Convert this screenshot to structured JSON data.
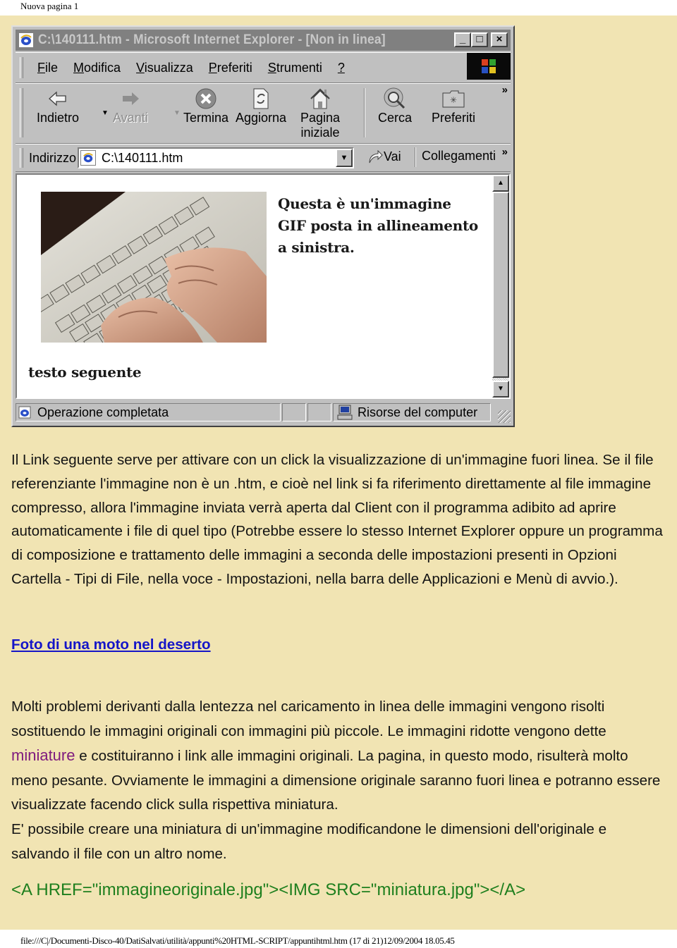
{
  "page": {
    "header_title": "Nuova pagina 1",
    "footer_path": "file:///C|/Documenti-Disco-40/DatiSalvati/utilità/appunti%20HTML-SCRIPT/appuntihtml.htm (17 di 21)12/09/2004 18.05.45",
    "background_color": "#f1e4b3"
  },
  "ie_window": {
    "title": "C:\\140111.htm - Microsoft Internet Explorer - [Non in linea]",
    "window_buttons": {
      "minimize": "_",
      "maximize": "□",
      "close": "×"
    },
    "menu": [
      {
        "label": "File",
        "access_key": "F"
      },
      {
        "label": "Modifica",
        "access_key": "M"
      },
      {
        "label": "Visualizza",
        "access_key": "V"
      },
      {
        "label": "Preferiti",
        "access_key": "P"
      },
      {
        "label": "Strumenti",
        "access_key": "S"
      },
      {
        "label": "?",
        "access_key": "?"
      }
    ],
    "toolbar": {
      "back": "Indietro",
      "forward": "Avanti",
      "stop": "Termina",
      "refresh": "Aggiorna",
      "home_line1": "Pagina",
      "home_line2": "iniziale",
      "search": "Cerca",
      "favorites": "Preferiti",
      "more": "»"
    },
    "address": {
      "label": "Indirizzo",
      "value": "C:\\140111.htm",
      "go": "Vai",
      "links": "Collegamenti",
      "more": "»"
    },
    "viewport": {
      "caption_line1": "Questa è un'immagine",
      "caption_line2": "GIF posta in allineamento",
      "caption_line3": "a sinistra.",
      "following_text": "testo seguente",
      "image_alt": "keyboard-typing-photo"
    },
    "status": {
      "text": "Operazione completata",
      "zone": "Risorse del computer"
    }
  },
  "content": {
    "paragraph1": "Il Link seguente serve per attivare con un click la visualizzazione di un'immagine fuori linea. Se il file referenziante l'immagine non è un .htm, e cioè nel link si fa riferimento direttamente al file immagine compresso, allora l'immagine inviata verrà aperta dal Client con il programma adibito ad aprire automaticamente i file di quel tipo (Potrebbe essere lo stesso Internet Explorer oppure un programma di composizione e trattamento delle immagini a seconda delle impostazioni presenti in Opzioni Cartella - Tipi di File, nella voce - Impostazioni, nella barra delle Applicazioni e Menù di avvio.).",
    "link_foto": "Foto di una moto nel deserto",
    "paragraph2_before": "Molti problemi derivanti dalla lentezza nel caricamento in linea delle immagini vengono risolti sostituendo le immagini originali con immagini più piccole. Le immagini ridotte vengono dette ",
    "miniature_link": "miniature",
    "paragraph2_after": " e costituiranno i link alle immagini originali. La pagina, in questo modo, risulterà molto meno pesante. Ovviamente le immagini a dimensione originale saranno fuori linea e potranno essere visualizzate facendo click sulla rispettiva miniatura.",
    "paragraph3": "E' possibile creare una miniatura di un'immagine modificandone le dimensioni dell'originale e salvando il file con un altro nome.",
    "code_example": "<A HREF=\"immagineoriginale.jpg\"><IMG SRC=\"miniatura.jpg\"></A>",
    "colors": {
      "text": "#141414",
      "link": "#1515c8",
      "visited_link": "#7e1a7e",
      "code": "#1e7f1e"
    }
  }
}
